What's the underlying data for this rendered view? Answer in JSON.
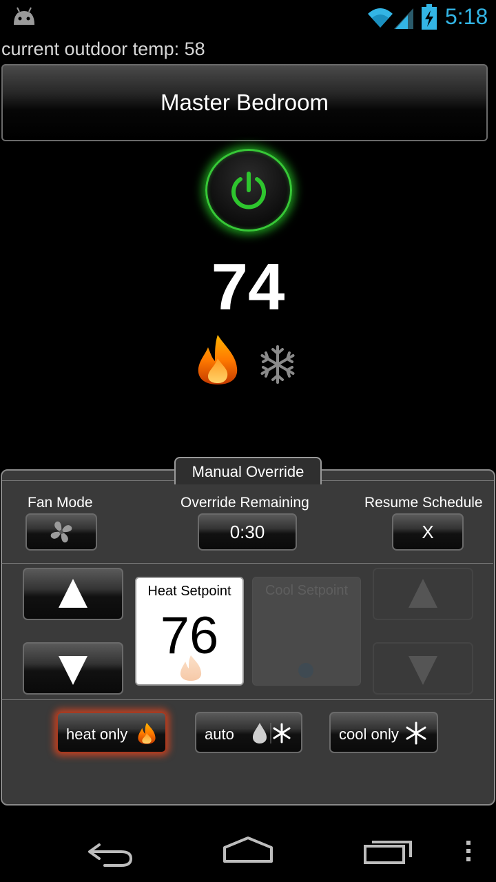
{
  "status_bar": {
    "time": "5:18",
    "icons": [
      "android-icon",
      "wifi-icon",
      "cell-signal-icon",
      "battery-charging-icon"
    ],
    "accent_color": "#33b5e5"
  },
  "outdoor": {
    "text": "current outdoor temp: 58"
  },
  "room": {
    "name": "Master Bedroom"
  },
  "power": {
    "icon": "power-icon",
    "state": "on",
    "glow_color": "#37c837"
  },
  "current": {
    "temperature": "74",
    "heating_active": true,
    "cooling_active": false
  },
  "panel": {
    "tab_label": "Manual Override",
    "fan_mode_label": "Fan Mode",
    "override_remaining_label": "Override Remaining",
    "override_remaining_value": "0:30",
    "resume_schedule_label": "Resume Schedule",
    "resume_schedule_button": "X",
    "heat_setpoint_label": "Heat Setpoint",
    "heat_setpoint_value": "76",
    "cool_setpoint_label": "Cool Setpoint",
    "modes": [
      {
        "label": "heat only",
        "icon": "flame-icon",
        "active": true
      },
      {
        "label": "auto",
        "icon": "drop-snowflake-icon",
        "active": false
      },
      {
        "label": "cool only",
        "icon": "snowflake-icon",
        "active": false
      }
    ]
  },
  "nav": {
    "icons": [
      "back-icon",
      "home-icon",
      "recents-icon",
      "menu-icon"
    ]
  }
}
